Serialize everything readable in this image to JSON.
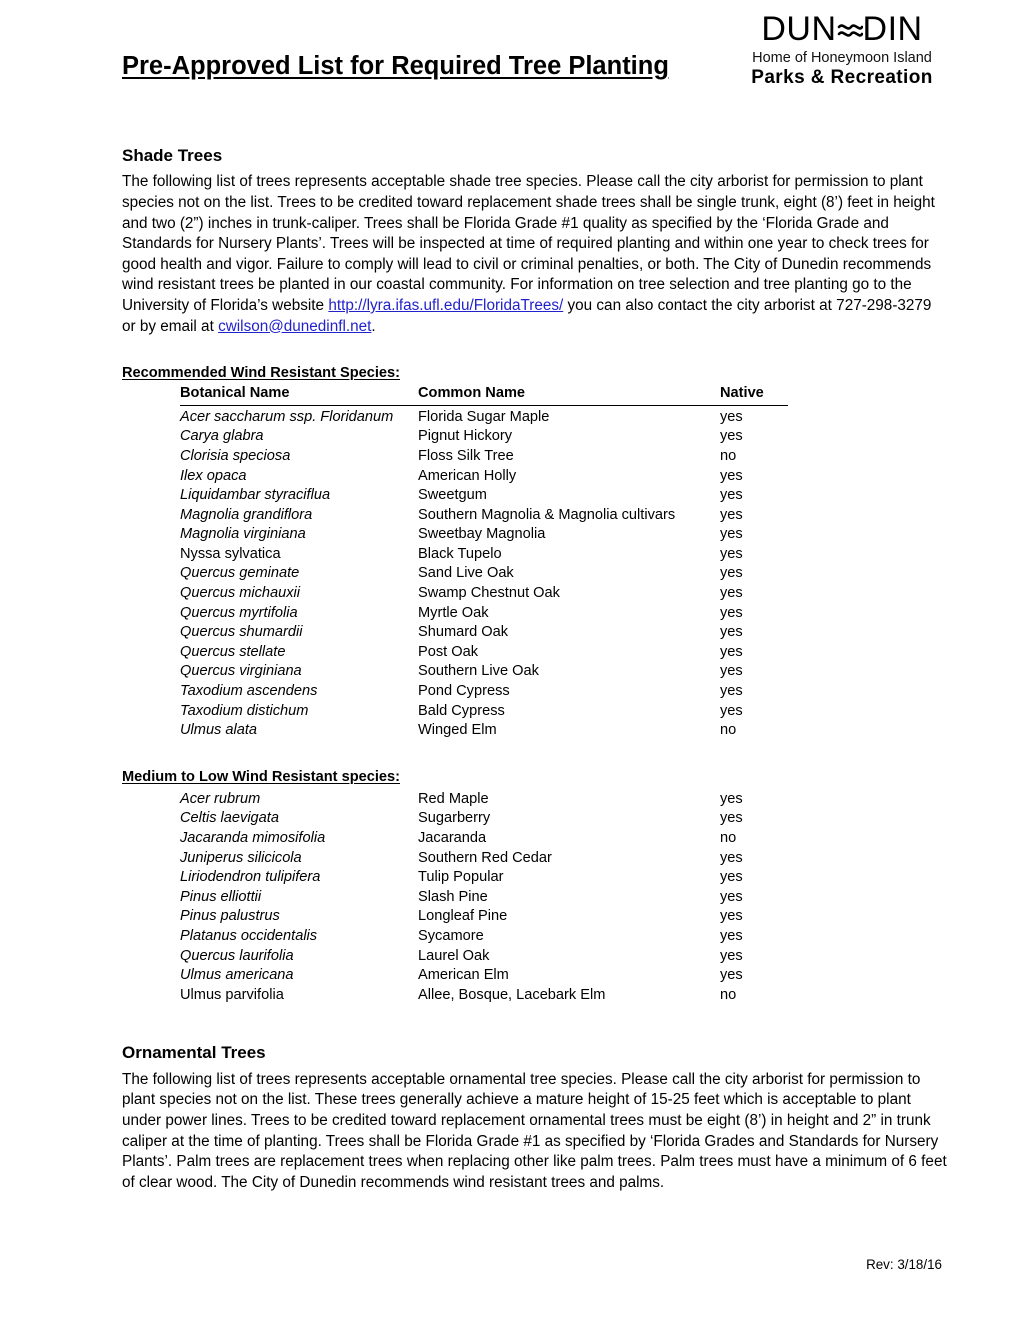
{
  "header": {
    "title": "Pre-Approved List for Required Tree Planting",
    "logo": {
      "wordmark_pre": "DUN",
      "wordmark_post": "DIN",
      "wave_icon": "wave-glyph",
      "tagline": "Home of Honeymoon Island",
      "department": "Parks & Recreation"
    }
  },
  "shade": {
    "heading": "Shade Trees",
    "paragraph_1": "The following list of trees represents acceptable shade tree species.  Please call the city arborist for permission to plant species not on the list. Trees to be credited toward replacement shade trees shall be single trunk, eight (8’) feet in height and two (2”) inches in trunk-caliper. Trees shall be Florida Grade #1 quality as specified by the ‘Florida Grade and Standards for Nursery Plants’. Trees will be inspected at time of required planting and within one year to check trees for good health and vigor. Failure to comply will lead to civil or criminal penalties, or both. The City of Dunedin recommends wind resistant trees be planted in our coastal community. For information on tree selection and tree planting go to the University of Florida’s website ",
    "link_url_text": "http://lyra.ifas.ufl.edu/FloridaTrees/",
    "paragraph_2": " you can also contact the city arborist at 727-298-3279 or by email at ",
    "link_email_text": "cwilson@dunedinfl.net",
    "paragraph_3": "."
  },
  "table_headers": {
    "botanical": "Botanical Name",
    "common": "Common Name",
    "native": "Native"
  },
  "recommended": {
    "title": "Recommended Wind Resistant Species:",
    "rows": [
      {
        "botanical": "Acer saccharum ssp. Floridanum",
        "italic": true,
        "common": "Florida Sugar Maple",
        "native": "yes"
      },
      {
        "botanical": "Carya glabra",
        "italic": true,
        "common": "Pignut Hickory",
        "native": "yes"
      },
      {
        "botanical": "Clorisia speciosa",
        "italic": true,
        "common": "Floss Silk Tree",
        "native": "no"
      },
      {
        "botanical": "Ilex opaca",
        "italic": true,
        "common": "American Holly",
        "native": "yes"
      },
      {
        "botanical": "Liquidambar styraciflua",
        "italic": true,
        "common": "Sweetgum",
        "native": "yes"
      },
      {
        "botanical": "Magnolia grandiflora",
        "italic": true,
        "common": "Southern Magnolia & Magnolia cultivars",
        "native": "yes"
      },
      {
        "botanical": "Magnolia virginiana",
        "italic": true,
        "common": "Sweetbay Magnolia",
        "native": "yes"
      },
      {
        "botanical": "Nyssa sylvatica",
        "italic": false,
        "common": "Black Tupelo",
        "native": "yes"
      },
      {
        "botanical": "Quercus geminate",
        "italic": true,
        "common": "Sand Live Oak",
        "native": "yes"
      },
      {
        "botanical": "Quercus michauxii",
        "italic": true,
        "common": "Swamp Chestnut Oak",
        "native": "yes"
      },
      {
        "botanical": "Quercus myrtifolia",
        "italic": true,
        "common": "Myrtle Oak",
        "native": "yes"
      },
      {
        "botanical": "Quercus shumardii",
        "italic": true,
        "common": "Shumard Oak",
        "native": "yes"
      },
      {
        "botanical": "Quercus stellate",
        "italic": true,
        "common": "Post Oak",
        "native": "yes"
      },
      {
        "botanical": "Quercus virginiana",
        "italic": true,
        "common": "Southern Live Oak",
        "native": "yes"
      },
      {
        "botanical": "Taxodium ascendens",
        "italic": true,
        "common": "Pond Cypress",
        "native": "yes"
      },
      {
        "botanical": "Taxodium distichum",
        "italic": true,
        "common": "Bald Cypress",
        "native": "yes"
      },
      {
        "botanical": "Ulmus alata",
        "italic": true,
        "common": "Winged Elm",
        "native": "no"
      }
    ]
  },
  "medium_low": {
    "title": "Medium to Low Wind Resistant species:",
    "rows": [
      {
        "botanical": "Acer rubrum",
        "italic": true,
        "common": "Red Maple",
        "native": "yes"
      },
      {
        "botanical": "Celtis laevigata",
        "italic": true,
        "common": "Sugarberry",
        "native": "yes"
      },
      {
        "botanical": "Jacaranda mimosifolia",
        "italic": true,
        "common": "Jacaranda",
        "native": "no"
      },
      {
        "botanical": "Juniperus silicicola",
        "italic": true,
        "common": "Southern Red Cedar",
        "native": "yes"
      },
      {
        "botanical": "Liriodendron tulipifera",
        "italic": true,
        "common": "Tulip Popular",
        "native": "yes"
      },
      {
        "botanical": "Pinus elliottii",
        "italic": true,
        "common": "Slash Pine",
        "native": "yes"
      },
      {
        "botanical": "Pinus palustrus",
        "italic": true,
        "common": "Longleaf Pine",
        "native": "yes"
      },
      {
        "botanical": "Platanus occidentalis",
        "italic": true,
        "common": "Sycamore",
        "native": "yes"
      },
      {
        "botanical": "Quercus laurifolia",
        "italic": true,
        "common": "Laurel Oak",
        "native": "yes"
      },
      {
        "botanical": "Ulmus americana",
        "italic": true,
        "common": "American Elm",
        "native": "yes"
      },
      {
        "botanical": "Ulmus parvifolia",
        "italic": false,
        "common": "Allee, Bosque, Lacebark Elm",
        "native": "no"
      }
    ]
  },
  "ornamental": {
    "heading": "Ornamental Trees",
    "paragraph": "The following list of trees represents acceptable ornamental tree species. Please call the city arborist for permission to plant species not on the list.  These trees generally achieve a mature height of 15-25 feet which is acceptable to plant under power lines. Trees to be credited toward replacement ornamental trees must be eight (8’) in height and 2” in trunk caliper at the time of planting. Trees shall be Florida Grade #1 as specified by ‘Florida Grades and Standards for Nursery Plants’. Palm trees are replacement trees when replacing other like palm trees. Palm trees must have a minimum of 6 feet of clear wood. The City of Dunedin recommends wind resistant trees and palms."
  },
  "footer": {
    "revision": "Rev: 3/18/16"
  }
}
